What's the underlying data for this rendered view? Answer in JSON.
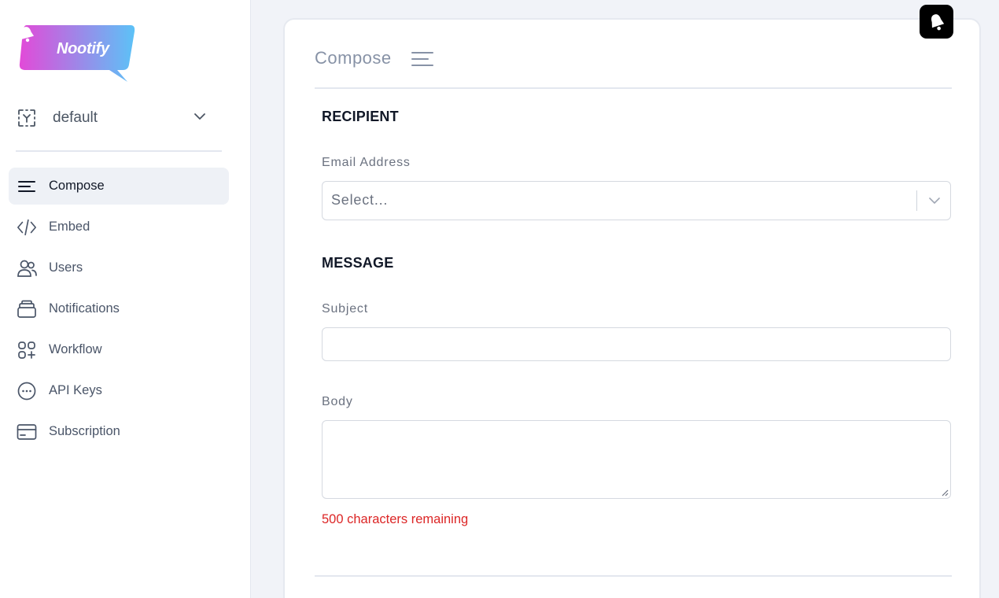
{
  "brand": {
    "name": "Nootify"
  },
  "workspace": {
    "label": "default"
  },
  "sidebar": {
    "items": [
      {
        "label": "Compose",
        "icon": "lines-icon",
        "active": true
      },
      {
        "label": "Embed",
        "icon": "code-icon",
        "active": false
      },
      {
        "label": "Users",
        "icon": "users-icon",
        "active": false
      },
      {
        "label": "Notifications",
        "icon": "stack-icon",
        "active": false
      },
      {
        "label": "Workflow",
        "icon": "grid-plus-icon",
        "active": false
      },
      {
        "label": "API Keys",
        "icon": "dots-circle-icon",
        "active": false
      },
      {
        "label": "Subscription",
        "icon": "card-icon",
        "active": false
      }
    ]
  },
  "main": {
    "title": "Compose",
    "recipient": {
      "section_title": "RECIPIENT",
      "email_label": "Email Address",
      "email_placeholder": "Select..."
    },
    "message": {
      "section_title": "MESSAGE",
      "subject_label": "Subject",
      "subject_value": "",
      "body_label": "Body",
      "body_value": "",
      "char_count": "500 characters remaining"
    }
  },
  "colors": {
    "brand_gradient_start": "#e24ad8",
    "brand_gradient_end": "#5cc2f7",
    "accent_error": "#dc2626",
    "active_nav_bg": "#eef1f6"
  }
}
